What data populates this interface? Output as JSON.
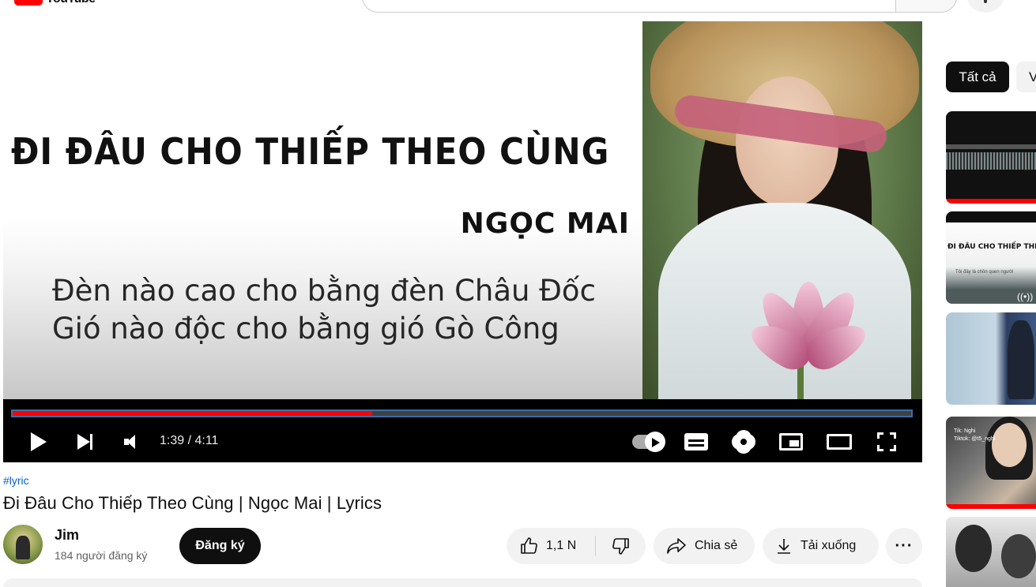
{
  "header": {
    "logo_text": "YouTube"
  },
  "player": {
    "thumbnail": {
      "title": "ĐI ĐÂU CHO THIẾP THEO CÙNG",
      "artist": "NGỌC MAI",
      "lyric_line_1": "Đèn nào cao cho bằng đèn Châu Đốc",
      "lyric_line_2": "Gió nào độc cho bằng gió Gò Công"
    },
    "time_display": "1:39 / 4:11",
    "progress_fraction": 0.4,
    "progress_color": "#ff0000",
    "controls": [
      "play-icon",
      "next-icon",
      "volume-icon",
      "autoplay-toggle",
      "captions-icon",
      "settings-icon",
      "miniplayer-icon",
      "theater-icon",
      "fullscreen-icon"
    ]
  },
  "video": {
    "hashtag": "#lyric",
    "title": "Đi Đâu Cho Thiếp Theo Cùng | Ngọc Mai | Lyrics"
  },
  "channel": {
    "name": "Jim",
    "subscribers": "184 người đăng ký",
    "subscribe_label": "Đăng ký"
  },
  "actions": {
    "like_count": "1,1 N",
    "share_label": "Chia sẻ",
    "download_label": "Tải xuống",
    "more_label": "···"
  },
  "sidebar": {
    "chips": [
      "Tất cả",
      "V"
    ],
    "recommended": [
      {
        "thumb_title": "",
        "thumb_caption": ""
      },
      {
        "thumb_title": "ĐI ĐÂU CHO THIẾP THEO",
        "thumb_caption": "Tôi đây là chồn quen người"
      },
      {
        "thumb_title": "",
        "thumb_caption": ""
      },
      {
        "thumb_title": "",
        "thumb_caption": "Tik: Nghi\nTiktok: @t5_nghi"
      },
      {
        "thumb_title": "",
        "thumb_caption": ""
      }
    ]
  },
  "colors": {
    "accent_red": "#ff0000",
    "link_blue": "#065fd4",
    "chip_dark": "#0f0f0f",
    "pill_bg": "#f2f2f2"
  }
}
